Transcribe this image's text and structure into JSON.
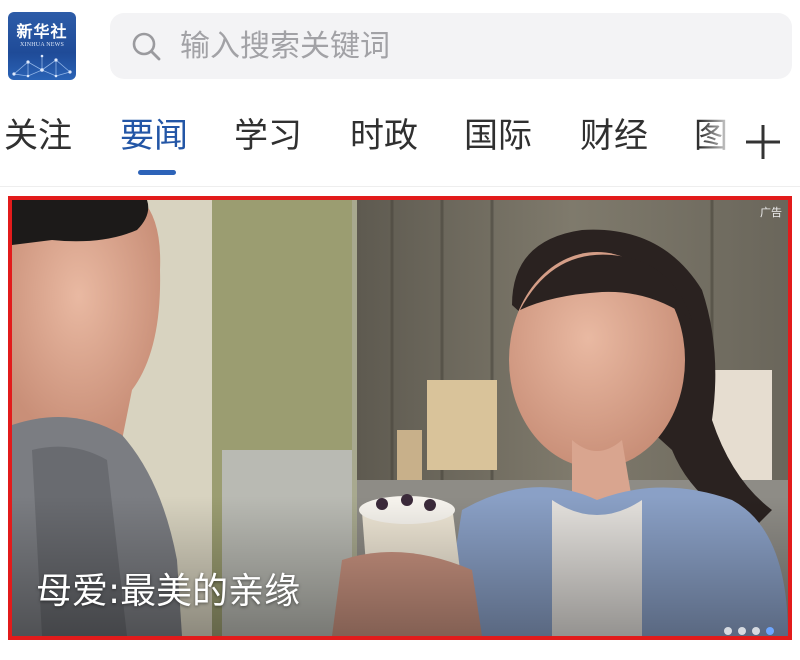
{
  "header": {
    "logo": {
      "name_cn": "新华社",
      "name_en": "XINHUA NEWS"
    },
    "search": {
      "placeholder": "输入搜索关键词",
      "value": "",
      "icon": "search-icon"
    }
  },
  "tabs": {
    "items": [
      "关注",
      "要闻",
      "学习",
      "时政",
      "国际",
      "财经",
      "图"
    ],
    "active_index": 1,
    "add_icon": "plus-icon"
  },
  "banner": {
    "caption": "母爱:最美的亲缘",
    "ad_label": "广告",
    "dot_count": 4,
    "active_dot": 3
  },
  "colors": {
    "accent": "#2356a6",
    "highlight_border": "#e21b1b",
    "logo_bg": "#1f4b98",
    "search_bg": "#f3f3f5"
  }
}
